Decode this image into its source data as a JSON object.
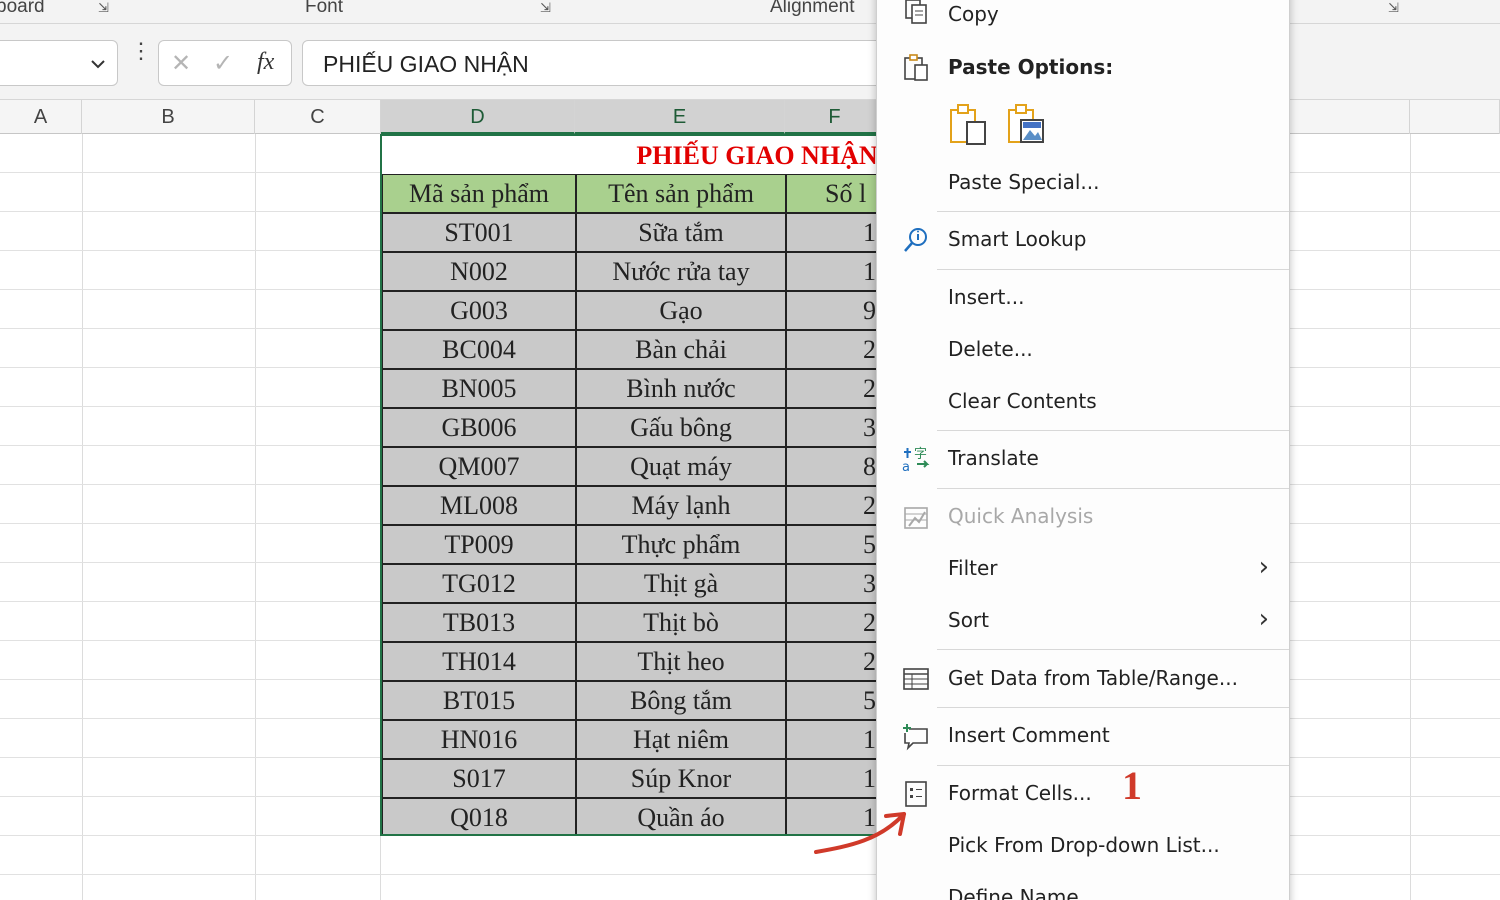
{
  "ribbon": {
    "groups": [
      "board",
      "Font",
      "Alignment"
    ],
    "launcher_glyph": "⇲"
  },
  "formula_bar": {
    "cancel_glyph": "✕",
    "enter_glyph": "✓",
    "fx_label": "fx",
    "content": "PHIẾU GIAO NHẬN"
  },
  "columns": [
    "A",
    "B",
    "C",
    "D",
    "E",
    "F"
  ],
  "table": {
    "title": "PHIẾU GIAO NHẬN",
    "headers": [
      "Mã sản phẩm",
      "Tên sản phẩm",
      "Số l"
    ],
    "rows": [
      [
        "ST001",
        "Sữa tắm",
        "1"
      ],
      [
        "N002",
        "Nước rửa tay",
        "1"
      ],
      [
        "G003",
        "Gạo",
        "9"
      ],
      [
        "BC004",
        "Bàn chải",
        "2"
      ],
      [
        "BN005",
        "Bình nước",
        "2"
      ],
      [
        "GB006",
        "Gấu bông",
        "3"
      ],
      [
        "QM007",
        "Quạt máy",
        "8"
      ],
      [
        "ML008",
        "Máy lạnh",
        "2"
      ],
      [
        "TP009",
        "Thực phẩm",
        "5"
      ],
      [
        "TG012",
        "Thịt gà",
        "3"
      ],
      [
        "TB013",
        "Thịt bò",
        "2"
      ],
      [
        "TH014",
        "Thịt heo",
        "2"
      ],
      [
        "BT015",
        "Bông tắm",
        "5"
      ],
      [
        "HN016",
        "Hạt niêm",
        "1"
      ],
      [
        "S017",
        "Súp Knor",
        "1"
      ],
      [
        "Q018",
        "Quần áo",
        "1"
      ]
    ]
  },
  "context_menu": {
    "items": [
      {
        "label": "Copy",
        "icon": "copy-icon"
      },
      {
        "label": "Paste Options:",
        "icon": "paste-icon"
      },
      {
        "label": "Paste Special..."
      },
      {
        "label": "Smart Lookup",
        "icon": "smart-lookup-icon"
      },
      {
        "label": "Insert..."
      },
      {
        "label": "Delete..."
      },
      {
        "label": "Clear Contents"
      },
      {
        "label": "Translate",
        "icon": "translate-icon"
      },
      {
        "label": "Quick Analysis",
        "icon": "quick-analysis-icon",
        "disabled": true
      },
      {
        "label": "Filter"
      },
      {
        "label": "Sort"
      },
      {
        "label": "Get Data from Table/Range...",
        "icon": "table-icon"
      },
      {
        "label": "Insert Comment",
        "icon": "comment-icon"
      },
      {
        "label": "Format Cells...",
        "icon": "format-cells-icon"
      },
      {
        "label": "Pick From Drop-down List..."
      },
      {
        "label": "Define Name"
      }
    ],
    "submenu_glyph": "›"
  },
  "annotation": {
    "step_number": "1",
    "color": "#d03a2a"
  },
  "colors": {
    "selection_border": "#217346",
    "header_fill": "#a9d08e",
    "cell_fill": "#c9c9c9",
    "title_red": "#e20000"
  }
}
